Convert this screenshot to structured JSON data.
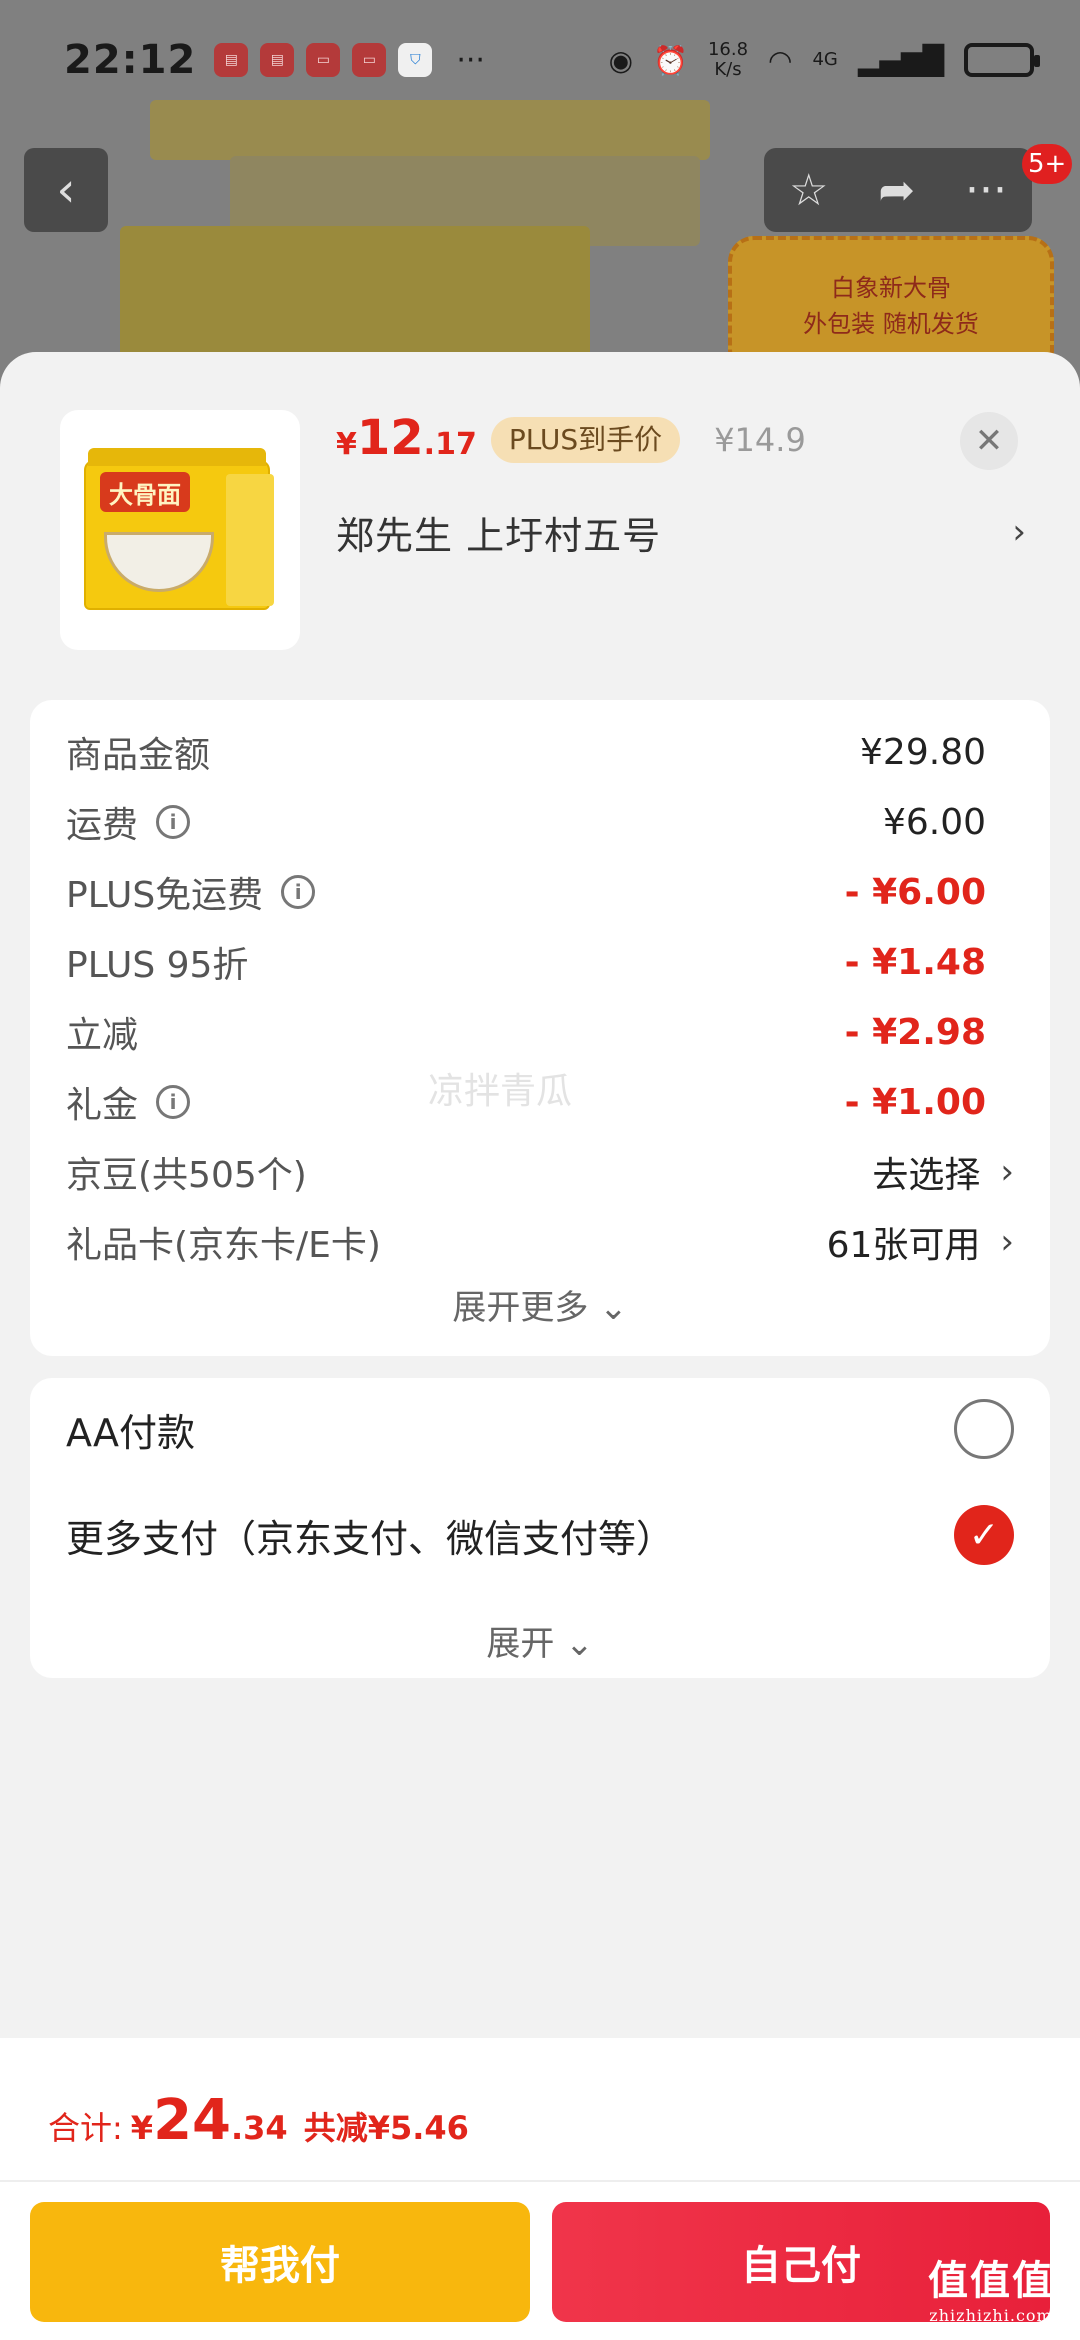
{
  "status_bar": {
    "time": "22:12",
    "net_speed_value": "16.8",
    "net_speed_unit": "K/s",
    "network": "4G",
    "app_icons": [
      "huawei-app-icon",
      "huawei-app-icon",
      "huawei-app-icon",
      "huawei-app-icon",
      "shield-app-icon"
    ],
    "more": "···"
  },
  "background": {
    "promo_line1": "白象新大骨",
    "promo_line2": "外包装 随机发货",
    "badge": "5+"
  },
  "product": {
    "package_label": "大骨面",
    "price_currency": "¥",
    "price_int": "12",
    "price_dec": ".17",
    "plus_tag": "PLUS到手价",
    "original_price": "¥14.9",
    "address": "郑先生  上圩村五号"
  },
  "fees": [
    {
      "label": "商品金额",
      "value": "¥29.80",
      "info": false,
      "style": "normal"
    },
    {
      "label": "运费",
      "value": "¥6.00",
      "info": true,
      "style": "normal"
    },
    {
      "label": "PLUS免运费",
      "value": "- ¥6.00",
      "info": true,
      "style": "red"
    },
    {
      "label": "PLUS 95折",
      "value": "- ¥1.48",
      "info": false,
      "style": "red"
    },
    {
      "label": "立减",
      "value": "- ¥2.98",
      "info": false,
      "style": "red"
    },
    {
      "label": "礼金",
      "value": "- ¥1.00",
      "info": true,
      "style": "red"
    },
    {
      "label": "京豆(共505个)",
      "value": "去选择",
      "info": false,
      "style": "link"
    },
    {
      "label": "礼品卡(京东卡/E卡)",
      "value": "61张可用",
      "info": false,
      "style": "link"
    }
  ],
  "fees_expand": "展开更多",
  "watermark": "凉拌青瓜",
  "payment": {
    "options": [
      {
        "label": "AA付款",
        "selected": false
      },
      {
        "label": "更多支付（京东支付、微信支付等）",
        "selected": true
      }
    ],
    "expand": "展开"
  },
  "footer": {
    "total_label": "合计:",
    "total_currency": "¥",
    "total_int": "24",
    "total_dec": ".34",
    "saved": "共减¥5.46",
    "help_pay": "帮我付",
    "self_pay": "自己付"
  },
  "site_watermark": "值值值",
  "site_watermark_sub": "zhizhizhi.com",
  "colors": {
    "accent_red": "#e1251b",
    "help_button": "#f8b70d",
    "self_button": "#e8203a",
    "plus_tag_bg": "#f6dfb4"
  }
}
